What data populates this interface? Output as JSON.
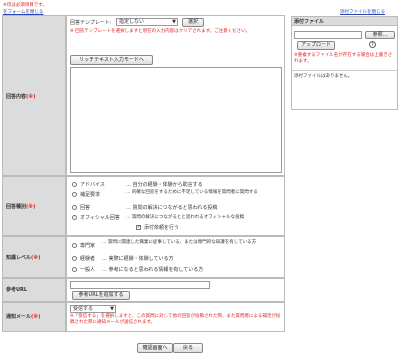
{
  "top": {
    "required_note": "※印は必須項目です。",
    "close_form": "をフォームを閉じる",
    "close_attach": "添付ファイルを閉じる"
  },
  "template": {
    "label": "回答テンプレート:",
    "selected": "指定しない",
    "button": "選択",
    "warning": "※ 回答テンプレートを選択しますと現在の入力内容はクリアされます。ご注意ください。"
  },
  "answer": {
    "label": "回答内容",
    "req": "(※)",
    "richtext_button": "リッチテキスト入力モードへ"
  },
  "type": {
    "label": "回答種別",
    "req": "(※)",
    "options": [
      {
        "name": "アドバイス",
        "desc": "自分の経験・体験から助言する"
      },
      {
        "name": "補足要求",
        "desc": "的確な回答をするために不足している情報を質問者に質問する"
      },
      {
        "name": "回答",
        "desc": "質問の解決につながると思われる投稿"
      },
      {
        "name": "オフィシャル回答",
        "desc": "質問の解決につながるとと思われるオフィシャルな投稿"
      }
    ],
    "check_label": "添付依頼を行う"
  },
  "knowledge": {
    "label": "知識レベル",
    "req": "(※)",
    "options": [
      {
        "name": "専門家",
        "desc": "質問に関連した職業に従事している、または専門的な知識を有している方"
      },
      {
        "name": "経験者",
        "desc": "実際に経験・体験している方"
      },
      {
        "name": "一般人",
        "desc": "参考になると思われる情報を有している方"
      }
    ]
  },
  "ref_url": {
    "label": "参考URL",
    "add_button": "参考URLを追加する"
  },
  "notify": {
    "label": "通知メール",
    "req": "(※)",
    "selected": "受信する",
    "note": "※「受信する」を選択しますと、この質問に対して他の回答が投稿された際、また質問者による補足が投稿された際に通知メールが送信されます。"
  },
  "attach": {
    "title": "添付ファイル",
    "ref_button": "参照...",
    "upload_button": "アップロード",
    "help": "?",
    "note": "※重複するファイル名が存在する場合は上書きされます。",
    "empty": "添付ファイルはありません。"
  },
  "footer": {
    "confirm": "確認画面へ",
    "back": "戻る"
  }
}
